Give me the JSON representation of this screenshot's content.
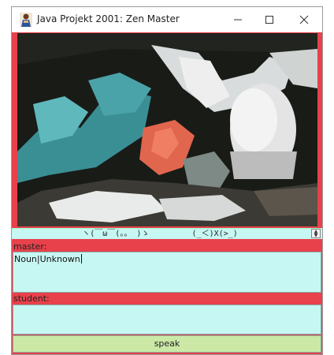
{
  "window": {
    "title": "Java Projekt 2001: Zen Master",
    "minimize_icon": "minimize-icon",
    "maximize_icon": "maximize-icon",
    "close_icon": "close-icon"
  },
  "image": {
    "subject": "whale-bones-seafloor-photo"
  },
  "emoticon_bar": {
    "text": "ヽ(￣ω￣(。。 )ゝ         (_＜)X(>_)",
    "spinner_icon": "spinner-icon"
  },
  "master": {
    "label": "master:",
    "value": "Noun|Unknown"
  },
  "student": {
    "label": "student:",
    "value": ""
  },
  "speak_button": {
    "label": "speak"
  },
  "colors": {
    "accent": "#e8414b",
    "field_bg": "#c7f7f2",
    "button_bg": "#cbe8a6"
  }
}
